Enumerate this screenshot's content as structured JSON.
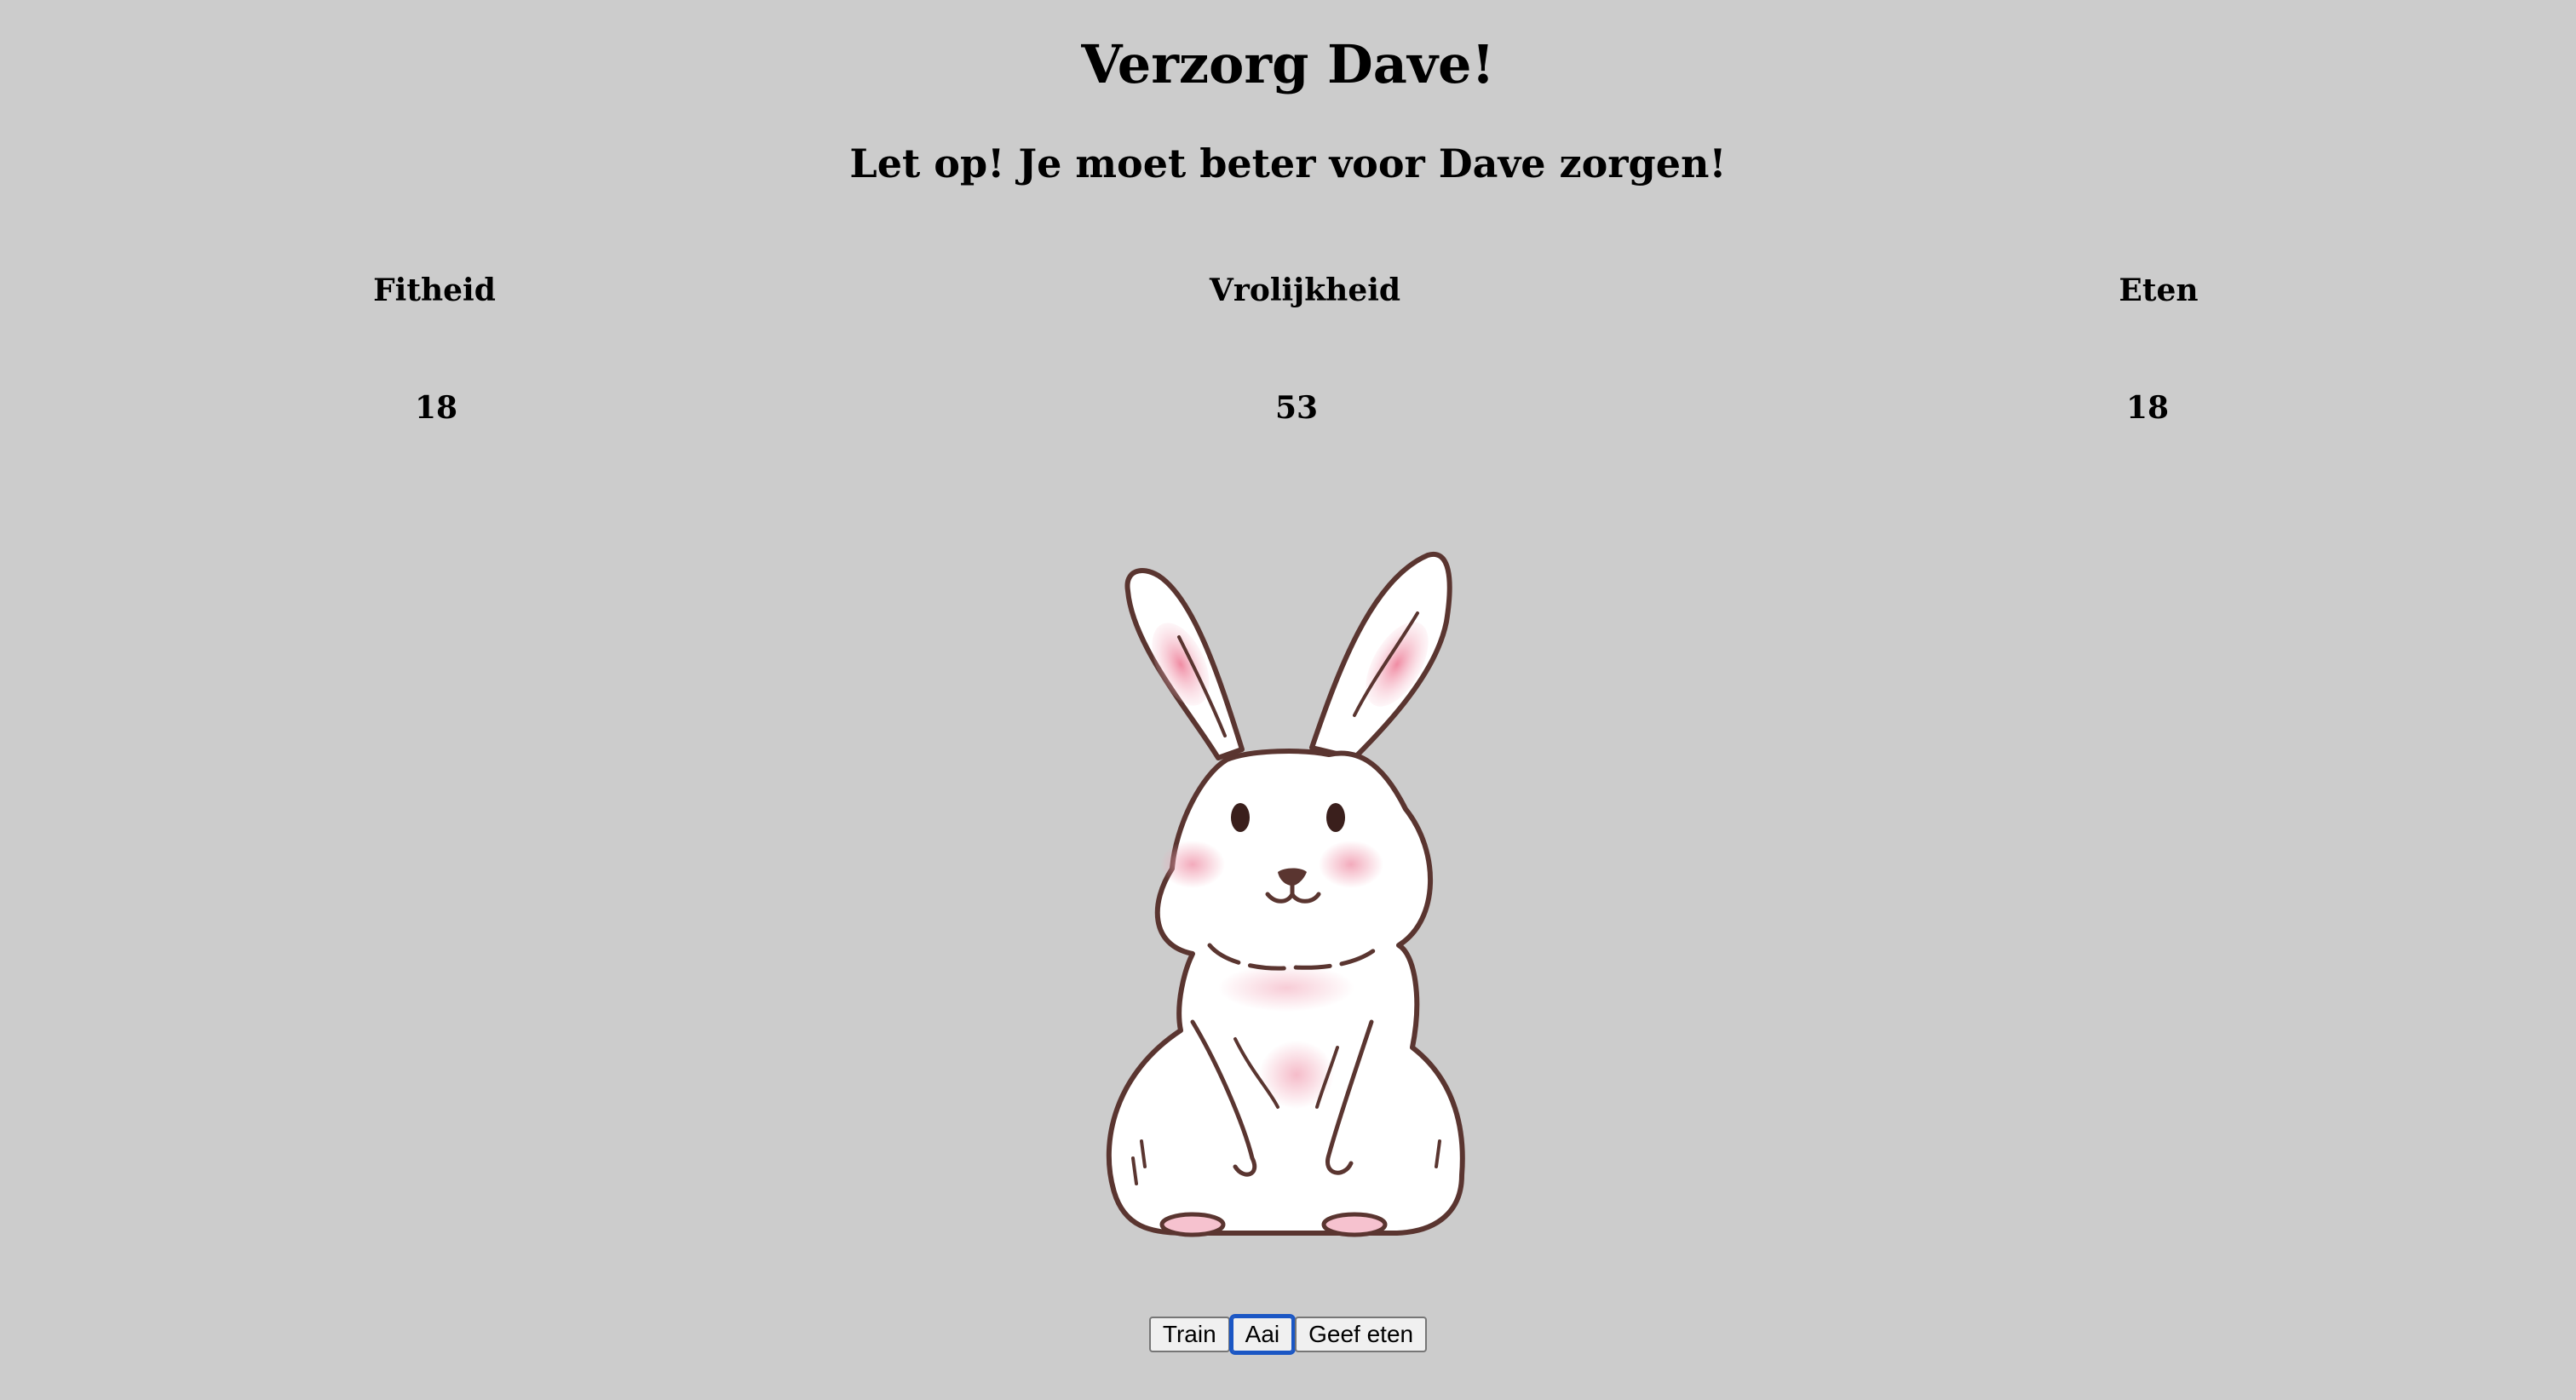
{
  "page": {
    "title": "Verzorg Dave!",
    "warning": "Let op! Je moet beter voor Dave zorgen!"
  },
  "stats": {
    "fitheid": {
      "label": "Fitheid",
      "value": "18"
    },
    "vrolijkheid": {
      "label": "Vrolijkheid",
      "value": "53"
    },
    "eten": {
      "label": "Eten",
      "value": "18"
    }
  },
  "bunny": {
    "name": "Dave",
    "icon": "rabbit-illustration",
    "colors": {
      "outline": "#5a3530",
      "fur": "#ffffff",
      "blush": "#f2a6b8"
    }
  },
  "controls": {
    "train_label": "Train",
    "aai_label": "Aai",
    "geef_eten_label": "Geef eten",
    "focused": "aai"
  },
  "theme": {
    "background": "#cccccc",
    "focus_color": "#1a56c4"
  }
}
